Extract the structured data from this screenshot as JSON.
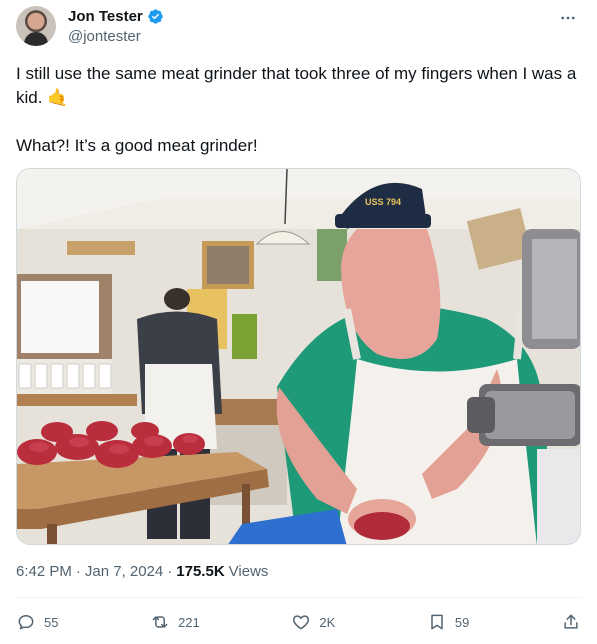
{
  "author": {
    "name": "Jon Tester",
    "handle": "@jontester",
    "verified": true,
    "avatar_icon": "avatar"
  },
  "tweet": {
    "line1": "I still use the same meat grinder that took three of my fingers when I was a kid.",
    "line2": "What?! It’s a good meat grinder!",
    "emoji": "🤙"
  },
  "media": {
    "cap_text": "USS 794"
  },
  "meta": {
    "time": "6:42 PM",
    "date": "Jan 7, 2024",
    "separator": "·",
    "views_count": "175.5K",
    "views_label": "Views"
  },
  "actions": {
    "replies": "55",
    "reposts": "221",
    "likes": "2K",
    "bookmarks": "59"
  },
  "colors": {
    "text": "#0f1419",
    "secondary": "#536471",
    "verified": "#1d9bf0",
    "border": "#cfd9de"
  }
}
